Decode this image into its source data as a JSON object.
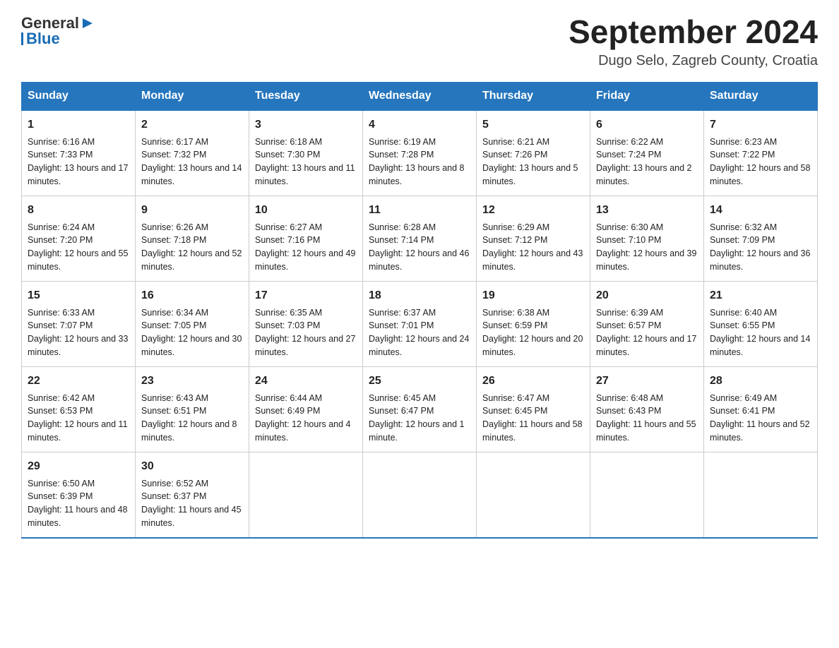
{
  "header": {
    "logo_general": "General",
    "logo_blue": "Blue",
    "month_title": "September 2024",
    "location": "Dugo Selo, Zagreb County, Croatia"
  },
  "days_of_week": [
    "Sunday",
    "Monday",
    "Tuesday",
    "Wednesday",
    "Thursday",
    "Friday",
    "Saturday"
  ],
  "weeks": [
    [
      {
        "day": "1",
        "sunrise": "6:16 AM",
        "sunset": "7:33 PM",
        "daylight": "13 hours and 17 minutes."
      },
      {
        "day": "2",
        "sunrise": "6:17 AM",
        "sunset": "7:32 PM",
        "daylight": "13 hours and 14 minutes."
      },
      {
        "day": "3",
        "sunrise": "6:18 AM",
        "sunset": "7:30 PM",
        "daylight": "13 hours and 11 minutes."
      },
      {
        "day": "4",
        "sunrise": "6:19 AM",
        "sunset": "7:28 PM",
        "daylight": "13 hours and 8 minutes."
      },
      {
        "day": "5",
        "sunrise": "6:21 AM",
        "sunset": "7:26 PM",
        "daylight": "13 hours and 5 minutes."
      },
      {
        "day": "6",
        "sunrise": "6:22 AM",
        "sunset": "7:24 PM",
        "daylight": "13 hours and 2 minutes."
      },
      {
        "day": "7",
        "sunrise": "6:23 AM",
        "sunset": "7:22 PM",
        "daylight": "12 hours and 58 minutes."
      }
    ],
    [
      {
        "day": "8",
        "sunrise": "6:24 AM",
        "sunset": "7:20 PM",
        "daylight": "12 hours and 55 minutes."
      },
      {
        "day": "9",
        "sunrise": "6:26 AM",
        "sunset": "7:18 PM",
        "daylight": "12 hours and 52 minutes."
      },
      {
        "day": "10",
        "sunrise": "6:27 AM",
        "sunset": "7:16 PM",
        "daylight": "12 hours and 49 minutes."
      },
      {
        "day": "11",
        "sunrise": "6:28 AM",
        "sunset": "7:14 PM",
        "daylight": "12 hours and 46 minutes."
      },
      {
        "day": "12",
        "sunrise": "6:29 AM",
        "sunset": "7:12 PM",
        "daylight": "12 hours and 43 minutes."
      },
      {
        "day": "13",
        "sunrise": "6:30 AM",
        "sunset": "7:10 PM",
        "daylight": "12 hours and 39 minutes."
      },
      {
        "day": "14",
        "sunrise": "6:32 AM",
        "sunset": "7:09 PM",
        "daylight": "12 hours and 36 minutes."
      }
    ],
    [
      {
        "day": "15",
        "sunrise": "6:33 AM",
        "sunset": "7:07 PM",
        "daylight": "12 hours and 33 minutes."
      },
      {
        "day": "16",
        "sunrise": "6:34 AM",
        "sunset": "7:05 PM",
        "daylight": "12 hours and 30 minutes."
      },
      {
        "day": "17",
        "sunrise": "6:35 AM",
        "sunset": "7:03 PM",
        "daylight": "12 hours and 27 minutes."
      },
      {
        "day": "18",
        "sunrise": "6:37 AM",
        "sunset": "7:01 PM",
        "daylight": "12 hours and 24 minutes."
      },
      {
        "day": "19",
        "sunrise": "6:38 AM",
        "sunset": "6:59 PM",
        "daylight": "12 hours and 20 minutes."
      },
      {
        "day": "20",
        "sunrise": "6:39 AM",
        "sunset": "6:57 PM",
        "daylight": "12 hours and 17 minutes."
      },
      {
        "day": "21",
        "sunrise": "6:40 AM",
        "sunset": "6:55 PM",
        "daylight": "12 hours and 14 minutes."
      }
    ],
    [
      {
        "day": "22",
        "sunrise": "6:42 AM",
        "sunset": "6:53 PM",
        "daylight": "12 hours and 11 minutes."
      },
      {
        "day": "23",
        "sunrise": "6:43 AM",
        "sunset": "6:51 PM",
        "daylight": "12 hours and 8 minutes."
      },
      {
        "day": "24",
        "sunrise": "6:44 AM",
        "sunset": "6:49 PM",
        "daylight": "12 hours and 4 minutes."
      },
      {
        "day": "25",
        "sunrise": "6:45 AM",
        "sunset": "6:47 PM",
        "daylight": "12 hours and 1 minute."
      },
      {
        "day": "26",
        "sunrise": "6:47 AM",
        "sunset": "6:45 PM",
        "daylight": "11 hours and 58 minutes."
      },
      {
        "day": "27",
        "sunrise": "6:48 AM",
        "sunset": "6:43 PM",
        "daylight": "11 hours and 55 minutes."
      },
      {
        "day": "28",
        "sunrise": "6:49 AM",
        "sunset": "6:41 PM",
        "daylight": "11 hours and 52 minutes."
      }
    ],
    [
      {
        "day": "29",
        "sunrise": "6:50 AM",
        "sunset": "6:39 PM",
        "daylight": "11 hours and 48 minutes."
      },
      {
        "day": "30",
        "sunrise": "6:52 AM",
        "sunset": "6:37 PM",
        "daylight": "11 hours and 45 minutes."
      },
      null,
      null,
      null,
      null,
      null
    ]
  ],
  "labels": {
    "sunrise_prefix": "Sunrise: ",
    "sunset_prefix": "Sunset: ",
    "daylight_prefix": "Daylight: "
  }
}
